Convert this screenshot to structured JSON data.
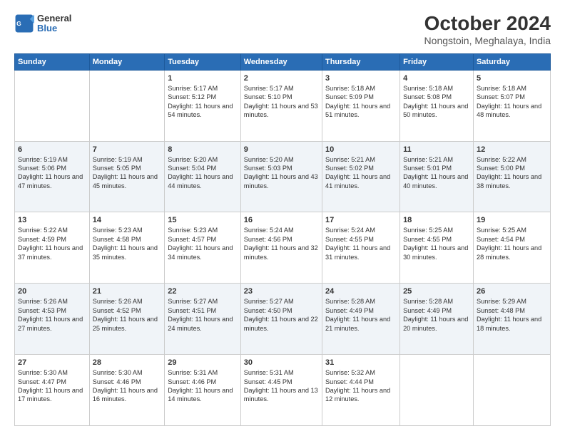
{
  "header": {
    "logo_line1": "General",
    "logo_line2": "Blue",
    "main_title": "October 2024",
    "subtitle": "Nongstoin, Meghalaya, India"
  },
  "columns": [
    "Sunday",
    "Monday",
    "Tuesday",
    "Wednesday",
    "Thursday",
    "Friday",
    "Saturday"
  ],
  "weeks": [
    {
      "row_id": 1,
      "cells": [
        {
          "day": "",
          "content": ""
        },
        {
          "day": "",
          "content": ""
        },
        {
          "day": "1",
          "content": "Sunrise: 5:17 AM\nSunset: 5:12 PM\nDaylight: 11 hours and 54 minutes."
        },
        {
          "day": "2",
          "content": "Sunrise: 5:17 AM\nSunset: 5:10 PM\nDaylight: 11 hours and 53 minutes."
        },
        {
          "day": "3",
          "content": "Sunrise: 5:18 AM\nSunset: 5:09 PM\nDaylight: 11 hours and 51 minutes."
        },
        {
          "day": "4",
          "content": "Sunrise: 5:18 AM\nSunset: 5:08 PM\nDaylight: 11 hours and 50 minutes."
        },
        {
          "day": "5",
          "content": "Sunrise: 5:18 AM\nSunset: 5:07 PM\nDaylight: 11 hours and 48 minutes."
        }
      ]
    },
    {
      "row_id": 2,
      "cells": [
        {
          "day": "6",
          "content": "Sunrise: 5:19 AM\nSunset: 5:06 PM\nDaylight: 11 hours and 47 minutes."
        },
        {
          "day": "7",
          "content": "Sunrise: 5:19 AM\nSunset: 5:05 PM\nDaylight: 11 hours and 45 minutes."
        },
        {
          "day": "8",
          "content": "Sunrise: 5:20 AM\nSunset: 5:04 PM\nDaylight: 11 hours and 44 minutes."
        },
        {
          "day": "9",
          "content": "Sunrise: 5:20 AM\nSunset: 5:03 PM\nDaylight: 11 hours and 43 minutes."
        },
        {
          "day": "10",
          "content": "Sunrise: 5:21 AM\nSunset: 5:02 PM\nDaylight: 11 hours and 41 minutes."
        },
        {
          "day": "11",
          "content": "Sunrise: 5:21 AM\nSunset: 5:01 PM\nDaylight: 11 hours and 40 minutes."
        },
        {
          "day": "12",
          "content": "Sunrise: 5:22 AM\nSunset: 5:00 PM\nDaylight: 11 hours and 38 minutes."
        }
      ]
    },
    {
      "row_id": 3,
      "cells": [
        {
          "day": "13",
          "content": "Sunrise: 5:22 AM\nSunset: 4:59 PM\nDaylight: 11 hours and 37 minutes."
        },
        {
          "day": "14",
          "content": "Sunrise: 5:23 AM\nSunset: 4:58 PM\nDaylight: 11 hours and 35 minutes."
        },
        {
          "day": "15",
          "content": "Sunrise: 5:23 AM\nSunset: 4:57 PM\nDaylight: 11 hours and 34 minutes."
        },
        {
          "day": "16",
          "content": "Sunrise: 5:24 AM\nSunset: 4:56 PM\nDaylight: 11 hours and 32 minutes."
        },
        {
          "day": "17",
          "content": "Sunrise: 5:24 AM\nSunset: 4:55 PM\nDaylight: 11 hours and 31 minutes."
        },
        {
          "day": "18",
          "content": "Sunrise: 5:25 AM\nSunset: 4:55 PM\nDaylight: 11 hours and 30 minutes."
        },
        {
          "day": "19",
          "content": "Sunrise: 5:25 AM\nSunset: 4:54 PM\nDaylight: 11 hours and 28 minutes."
        }
      ]
    },
    {
      "row_id": 4,
      "cells": [
        {
          "day": "20",
          "content": "Sunrise: 5:26 AM\nSunset: 4:53 PM\nDaylight: 11 hours and 27 minutes."
        },
        {
          "day": "21",
          "content": "Sunrise: 5:26 AM\nSunset: 4:52 PM\nDaylight: 11 hours and 25 minutes."
        },
        {
          "day": "22",
          "content": "Sunrise: 5:27 AM\nSunset: 4:51 PM\nDaylight: 11 hours and 24 minutes."
        },
        {
          "day": "23",
          "content": "Sunrise: 5:27 AM\nSunset: 4:50 PM\nDaylight: 11 hours and 22 minutes."
        },
        {
          "day": "24",
          "content": "Sunrise: 5:28 AM\nSunset: 4:49 PM\nDaylight: 11 hours and 21 minutes."
        },
        {
          "day": "25",
          "content": "Sunrise: 5:28 AM\nSunset: 4:49 PM\nDaylight: 11 hours and 20 minutes."
        },
        {
          "day": "26",
          "content": "Sunrise: 5:29 AM\nSunset: 4:48 PM\nDaylight: 11 hours and 18 minutes."
        }
      ]
    },
    {
      "row_id": 5,
      "cells": [
        {
          "day": "27",
          "content": "Sunrise: 5:30 AM\nSunset: 4:47 PM\nDaylight: 11 hours and 17 minutes."
        },
        {
          "day": "28",
          "content": "Sunrise: 5:30 AM\nSunset: 4:46 PM\nDaylight: 11 hours and 16 minutes."
        },
        {
          "day": "29",
          "content": "Sunrise: 5:31 AM\nSunset: 4:46 PM\nDaylight: 11 hours and 14 minutes."
        },
        {
          "day": "30",
          "content": "Sunrise: 5:31 AM\nSunset: 4:45 PM\nDaylight: 11 hours and 13 minutes."
        },
        {
          "day": "31",
          "content": "Sunrise: 5:32 AM\nSunset: 4:44 PM\nDaylight: 11 hours and 12 minutes."
        },
        {
          "day": "",
          "content": ""
        },
        {
          "day": "",
          "content": ""
        }
      ]
    }
  ]
}
